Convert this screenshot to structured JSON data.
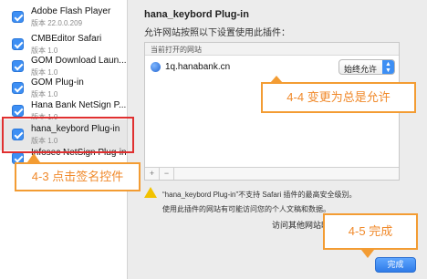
{
  "plugins": [
    {
      "name": "Adobe Flash Player",
      "version": "版本 22.0.0.209"
    },
    {
      "name": "CMBEditor Safari",
      "version": "版本 1.0"
    },
    {
      "name": "GOM Download Laun...",
      "version": "版本 1.0"
    },
    {
      "name": "GOM Plug-in",
      "version": "版本 1.0"
    },
    {
      "name": "Hana Bank NetSign P...",
      "version": "版本 1.0"
    },
    {
      "name": "hana_keybord Plug-in",
      "version": "版本 1.0"
    },
    {
      "name": "Infosec NetSign Plug-in",
      "version": ""
    }
  ],
  "panel": {
    "title": "hana_keybord Plug-in",
    "subtitle": "允许网站按照以下设置使用此插件：",
    "table_header": "当前打开的网站",
    "site": "1q.hanabank.cn",
    "permission": "始终允许",
    "add_btn": "+",
    "remove_btn": "−",
    "warning1": "“hana_keybord Plug-in”不支持 Safari 插件的最高安全级别。",
    "warning2": "使用此插件的网站有可能访问您的个人文稿和数据。",
    "other_sites": "访问其他网站时"
  },
  "done_label": "完成",
  "callouts": {
    "step4": "4-4  变更为总是允许",
    "step3": "4-3  点击签名控件",
    "step5": "4-5  完成"
  },
  "colors": {
    "accent": "#3d8ff4",
    "callout": "#f39c33",
    "highlight": "#e03030"
  }
}
